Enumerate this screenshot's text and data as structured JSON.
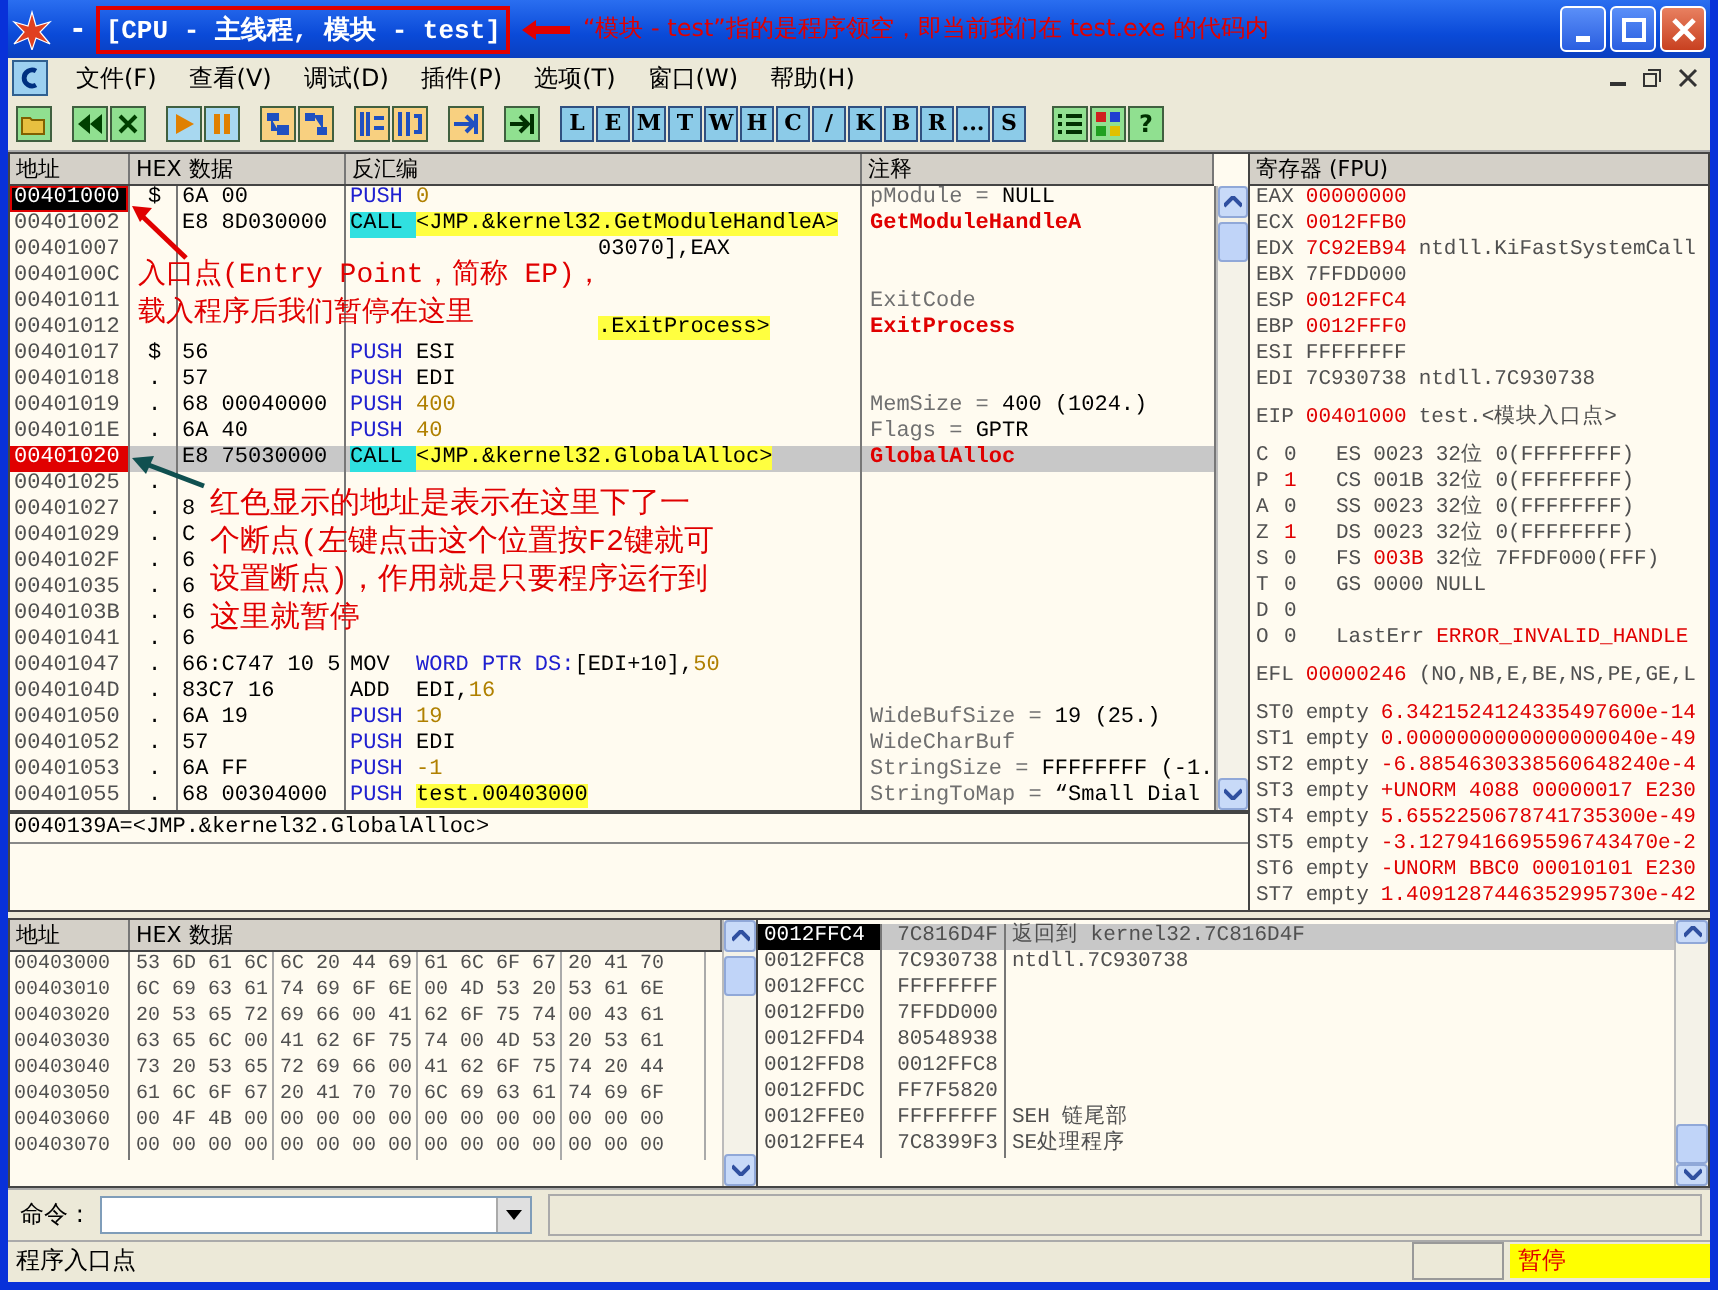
{
  "window": {
    "dash": "-",
    "title": "[CPU - 主线程, 模块 - test]",
    "note": "“模块 - test”指的是程序领空，即当前我们在 test.exe 的代码内"
  },
  "menu": [
    "文件(F)",
    "查看(V)",
    "调试(D)",
    "插件(P)",
    "选项(T)",
    "窗口(W)",
    "帮助(H)"
  ],
  "toolbar": {
    "letters": [
      "L",
      "E",
      "M",
      "T",
      "W",
      "H",
      "C",
      "/",
      "K",
      "B",
      "R",
      "...",
      "S"
    ],
    "help": "?"
  },
  "disasm": {
    "columns": [
      "地址",
      "HEX 数据",
      "反汇编",
      "注释"
    ],
    "rows": [
      {
        "addr": "00401000",
        "current": true,
        "breakpoint": false,
        "selected": false,
        "mark": "$",
        "hex": "6A 00",
        "op": {
          "text": "PUSH",
          "kind": "push"
        },
        "args": [
          {
            "text": "0",
            "kind": "const"
          }
        ],
        "comment": [
          {
            "text": "pModule = ",
            "kind": "arg"
          },
          {
            "text": "NULL",
            "kind": "value"
          }
        ]
      },
      {
        "addr": "00401002",
        "current": false,
        "breakpoint": false,
        "selected": false,
        "hex": "E8 8D030000",
        "op": {
          "text": "CALL",
          "kind": "call"
        },
        "args": [
          {
            "text": "<JMP.&kernel32.GetModuleHandleA>",
            "kind": "target"
          }
        ],
        "comment": [
          {
            "text": "GetModuleHandleA",
            "kind": "api"
          }
        ]
      },
      {
        "addr": "00401007",
        "current": false,
        "breakpoint": false,
        "selected": false,
        "args": [
          {
            "text": "03070],EAX",
            "kind": "tail"
          }
        ]
      },
      {
        "addr": "0040100C",
        "current": false,
        "breakpoint": false,
        "selected": false
      },
      {
        "addr": "00401011",
        "current": false,
        "breakpoint": false,
        "selected": false,
        "comment": [
          {
            "text": "ExitCode",
            "kind": "arg"
          }
        ]
      },
      {
        "addr": "00401012",
        "current": false,
        "breakpoint": false,
        "selected": false,
        "args": [
          {
            "text": ".ExitProcess>",
            "kind": "target-tail"
          }
        ],
        "comment": [
          {
            "text": "ExitProcess",
            "kind": "api"
          }
        ]
      },
      {
        "addr": "00401017",
        "current": false,
        "breakpoint": false,
        "selected": false,
        "mark": "$",
        "hex": "56",
        "op": {
          "text": "PUSH",
          "kind": "push"
        },
        "args": [
          {
            "text": "ESI",
            "kind": "plain"
          }
        ]
      },
      {
        "addr": "00401018",
        "current": false,
        "breakpoint": false,
        "selected": false,
        "mark": ".",
        "hex": "57",
        "op": {
          "text": "PUSH",
          "kind": "push"
        },
        "args": [
          {
            "text": "EDI",
            "kind": "plain"
          }
        ]
      },
      {
        "addr": "00401019",
        "current": false,
        "breakpoint": false,
        "selected": false,
        "mark": ".",
        "hex": "68 00040000",
        "op": {
          "text": "PUSH",
          "kind": "push"
        },
        "args": [
          {
            "text": "400",
            "kind": "const"
          }
        ],
        "comment": [
          {
            "text": "MemSize = ",
            "kind": "arg"
          },
          {
            "text": "400 (1024.)",
            "kind": "value"
          }
        ]
      },
      {
        "addr": "0040101E",
        "current": false,
        "breakpoint": false,
        "selected": false,
        "mark": ".",
        "hex": "6A 40",
        "op": {
          "text": "PUSH",
          "kind": "push"
        },
        "args": [
          {
            "text": "40",
            "kind": "const"
          }
        ],
        "comment": [
          {
            "text": "Flags = ",
            "kind": "arg"
          },
          {
            "text": "GPTR",
            "kind": "value"
          }
        ]
      },
      {
        "addr": "00401020",
        "current": false,
        "breakpoint": true,
        "selected": true,
        "hex": "E8 75030000",
        "op": {
          "text": "CALL",
          "kind": "call"
        },
        "args": [
          {
            "text": "<JMP.&kernel32.GlobalAlloc>",
            "kind": "target"
          }
        ],
        "comment": [
          {
            "text": "GlobalAlloc",
            "kind": "api"
          }
        ]
      },
      {
        "addr": "00401025",
        "current": false,
        "breakpoint": false,
        "selected": false,
        "mark": "."
      },
      {
        "addr": "00401027",
        "current": false,
        "breakpoint": false,
        "selected": false,
        "mark": ".",
        "hex": "8"
      },
      {
        "addr": "00401029",
        "current": false,
        "breakpoint": false,
        "selected": false,
        "mark": ".",
        "hex": "C"
      },
      {
        "addr": "0040102F",
        "current": false,
        "breakpoint": false,
        "selected": false,
        "mark": ".",
        "hex": "6"
      },
      {
        "addr": "00401035",
        "current": false,
        "breakpoint": false,
        "selected": false,
        "mark": ".",
        "hex": "6"
      },
      {
        "addr": "0040103B",
        "current": false,
        "breakpoint": false,
        "selected": false,
        "mark": ".",
        "hex": "6"
      },
      {
        "addr": "00401041",
        "current": false,
        "breakpoint": false,
        "selected": false,
        "mark": ".",
        "hex": "6"
      },
      {
        "addr": "00401047",
        "current": false,
        "breakpoint": false,
        "selected": false,
        "mark": ".",
        "hex": "66:C747 10 5",
        "op": {
          "text": "MOV",
          "kind": "plain"
        },
        "args": [
          {
            "text": "WORD PTR DS:",
            "kind": "kw"
          },
          {
            "text": "[EDI+10],",
            "kind": "plain"
          },
          {
            "text": "50",
            "kind": "const"
          }
        ]
      },
      {
        "addr": "0040104D",
        "current": false,
        "breakpoint": false,
        "selected": false,
        "mark": ".",
        "hex": "83C7 16",
        "op": {
          "text": "ADD",
          "kind": "plain"
        },
        "args": [
          {
            "text": "EDI,",
            "kind": "plain"
          },
          {
            "text": "16",
            "kind": "const"
          }
        ]
      },
      {
        "addr": "00401050",
        "current": false,
        "breakpoint": false,
        "selected": false,
        "mark": ".",
        "hex": "6A 19",
        "op": {
          "text": "PUSH",
          "kind": "push"
        },
        "args": [
          {
            "text": "19",
            "kind": "const"
          }
        ],
        "comment": [
          {
            "text": "WideBufSize = ",
            "kind": "arg"
          },
          {
            "text": "19 (25.)",
            "kind": "value"
          }
        ]
      },
      {
        "addr": "00401052",
        "current": false,
        "breakpoint": false,
        "selected": false,
        "mark": ".",
        "hex": "57",
        "op": {
          "text": "PUSH",
          "kind": "push"
        },
        "args": [
          {
            "text": "EDI",
            "kind": "plain"
          }
        ],
        "comment": [
          {
            "text": "WideCharBuf",
            "kind": "arg"
          }
        ]
      },
      {
        "addr": "00401053",
        "current": false,
        "breakpoint": false,
        "selected": false,
        "mark": ".",
        "hex": "6A FF",
        "op": {
          "text": "PUSH",
          "kind": "push"
        },
        "args": [
          {
            "text": "-1",
            "kind": "const"
          }
        ],
        "comment": [
          {
            "text": "StringSize = ",
            "kind": "arg"
          },
          {
            "text": "FFFFFFFF (-1.",
            "kind": "value"
          }
        ]
      },
      {
        "addr": "00401055",
        "current": false,
        "breakpoint": false,
        "selected": false,
        "mark": ".",
        "hex": "68 00304000",
        "op": {
          "text": "PUSH",
          "kind": "push"
        },
        "args": [
          {
            "text": "test.00403000",
            "kind": "target"
          }
        ],
        "comment": [
          {
            "text": "StringToMap = ",
            "kind": "arg"
          },
          {
            "text": "“Small Dial",
            "kind": "value"
          }
        ]
      }
    ],
    "info": "0040139A=<JMP.&kernel32.GlobalAlloc>"
  },
  "annotations": [
    {
      "kind": "entry",
      "lines": [
        "入口点(Entry Point，简称 EP)，",
        "载入程序后我们暂停在这里"
      ]
    },
    {
      "kind": "breakpoint",
      "lines": [
        "红色显示的地址是表示在这里下了一",
        "个断点(左键点击这个位置按F2键就可",
        "设置断点)，作用就是只要程序运行到",
        "这里就暂停"
      ]
    }
  ],
  "registers": {
    "title": "寄存器 (FPU)",
    "general": [
      {
        "name": "EAX",
        "value": "00000000",
        "changed": true
      },
      {
        "name": "ECX",
        "value": "0012FFB0",
        "changed": true
      },
      {
        "name": "EDX",
        "value": "7C92EB94",
        "changed": true,
        "note": "ntdll.KiFastSystemCall"
      },
      {
        "name": "EBX",
        "value": "7FFDD000",
        "changed": false
      },
      {
        "name": "ESP",
        "value": "0012FFC4",
        "changed": true
      },
      {
        "name": "EBP",
        "value": "0012FFF0",
        "changed": true
      },
      {
        "name": "ESI",
        "value": "FFFFFFFF",
        "changed": false
      },
      {
        "name": "EDI",
        "value": "7C930738",
        "changed": false,
        "note": "ntdll.7C930738"
      }
    ],
    "eip": {
      "name": "EIP",
      "value": "00401000",
      "changed": true,
      "note": "test.<模块入口点>"
    },
    "flags": [
      {
        "flag": "C",
        "value": "0",
        "changed": false,
        "segment": "ES",
        "selector": "0023",
        "selector_changed": false,
        "info": "32位 0(FFFFFFFF)"
      },
      {
        "flag": "P",
        "value": "1",
        "changed": true,
        "segment": "CS",
        "selector": "001B",
        "selector_changed": false,
        "info": "32位 0(FFFFFFFF)"
      },
      {
        "flag": "A",
        "value": "0",
        "changed": false,
        "segment": "SS",
        "selector": "0023",
        "selector_changed": false,
        "info": "32位 0(FFFFFFFF)"
      },
      {
        "flag": "Z",
        "value": "1",
        "changed": true,
        "segment": "DS",
        "selector": "0023",
        "selector_changed": false,
        "info": "32位 0(FFFFFFFF)"
      },
      {
        "flag": "S",
        "value": "0",
        "changed": false,
        "segment": "FS",
        "selector": "003B",
        "selector_changed": true,
        "info": "32位 7FFDF000(FFF)"
      },
      {
        "flag": "T",
        "value": "0",
        "changed": false,
        "segment": "GS",
        "selector": "0000",
        "selector_changed": false,
        "info": "NULL"
      },
      {
        "flag": "D",
        "value": "0",
        "changed": false
      },
      {
        "flag": "O",
        "value": "0",
        "changed": false,
        "last_error": {
          "label": "LastErr",
          "value": "ERROR_INVALID_HANDLE"
        }
      }
    ],
    "efl": {
      "name": "EFL",
      "value": "00000246",
      "changed": true,
      "note": "(NO,NB,E,BE,NS,PE,GE,L"
    },
    "fpu": [
      {
        "name": "ST0",
        "tag": "empty",
        "value": "6.3421524124335497600e-14"
      },
      {
        "name": "ST1",
        "tag": "empty",
        "value": "0.0000000000000000040e-49"
      },
      {
        "name": "ST2",
        "tag": "empty",
        "value": "-6.8854630338560648240e-4"
      },
      {
        "name": "ST3",
        "tag": "empty",
        "value": "+UNORM 4088 00000017 E230"
      },
      {
        "name": "ST4",
        "tag": "empty",
        "value": "5.6552250678741735300e-49"
      },
      {
        "name": "ST5",
        "tag": "empty",
        "value": "-3.1279416695596743470e-2"
      },
      {
        "name": "ST6",
        "tag": "empty",
        "value": "-UNORM BBC0 00010101 E230"
      },
      {
        "name": "ST7",
        "tag": "empty",
        "value": "1.4091287446352995730e-42"
      }
    ]
  },
  "dump": {
    "columns": [
      "地址",
      "HEX 数据"
    ],
    "rows": [
      {
        "addr": "00403000",
        "bytes": [
          "53 6D 61 6C",
          "6C 20 44 69",
          "61 6C 6F 67",
          "20 41 70"
        ]
      },
      {
        "addr": "00403010",
        "bytes": [
          "6C 69 63 61",
          "74 69 6F 6E",
          "00 4D 53 20",
          "53 61 6E"
        ]
      },
      {
        "addr": "00403020",
        "bytes": [
          "20 53 65 72",
          "69 66 00 41",
          "62 6F 75 74",
          "00 43 61"
        ]
      },
      {
        "addr": "00403030",
        "bytes": [
          "63 65 6C 00",
          "41 62 6F 75",
          "74 00 4D 53",
          "20 53 61"
        ]
      },
      {
        "addr": "00403040",
        "bytes": [
          "73 20 53 65",
          "72 69 66 00",
          "41 62 6F 75",
          "74 20 44"
        ]
      },
      {
        "addr": "00403050",
        "bytes": [
          "61 6C 6F 67",
          "20 41 70 70",
          "6C 69 63 61",
          "74 69 6F"
        ]
      },
      {
        "addr": "00403060",
        "bytes": [
          "00 4F 4B 00",
          "00 00 00 00",
          "00 00 00 00",
          "00 00 00"
        ]
      },
      {
        "addr": "00403070",
        "bytes": [
          "00 00 00 00",
          "00 00 00 00",
          "00 00 00 00",
          "00 00 00"
        ]
      }
    ]
  },
  "stack": {
    "rows": [
      {
        "addr": "0012FFC4",
        "value": "7C816D4F",
        "comment": "返回到 kernel32.7C816D4F",
        "selected": true
      },
      {
        "addr": "0012FFC8",
        "value": "7C930738",
        "comment": "ntdll.7C930738",
        "selected": false
      },
      {
        "addr": "0012FFCC",
        "value": "FFFFFFFF",
        "selected": false
      },
      {
        "addr": "0012FFD0",
        "value": "7FFDD000",
        "selected": false
      },
      {
        "addr": "0012FFD4",
        "value": "80548938",
        "selected": false
      },
      {
        "addr": "0012FFD8",
        "value": "0012FFC8",
        "selected": false
      },
      {
        "addr": "0012FFDC",
        "value": "FF7F5820",
        "selected": false
      },
      {
        "addr": "0012FFE0",
        "value": "FFFFFFFF",
        "comment": "SEH 链尾部",
        "selected": false
      },
      {
        "addr": "0012FFE4",
        "value": "7C8399F3",
        "comment": "SE处理程序",
        "selected": false
      }
    ]
  },
  "command": {
    "label": "命令 :"
  },
  "status": {
    "message": "程序入口点",
    "state": "暂停"
  }
}
